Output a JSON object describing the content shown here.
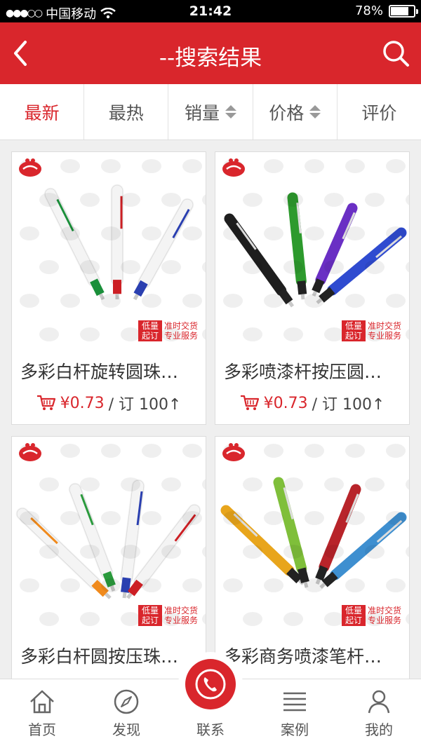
{
  "status_bar": {
    "carrier": "中国移动",
    "time": "21:42",
    "battery": "78%",
    "battery_level": 0.78
  },
  "nav": {
    "title": "--搜索结果",
    "back_icon": "chevron-left-icon",
    "search_icon": "search-icon"
  },
  "sort_tabs": [
    {
      "label": "最新",
      "active": true
    },
    {
      "label": "最热",
      "active": false
    },
    {
      "label": "销量",
      "active": false
    },
    {
      "label": "价格",
      "active": false
    },
    {
      "label": "评价",
      "active": false
    }
  ],
  "products": [
    {
      "name": "多彩白杆旋转圆珠…",
      "price": "¥0.73",
      "moq": "/ 订 100↑",
      "pen_colors": [
        "#1a8f3a",
        "#cc1f24",
        "#2a3fb0"
      ],
      "barrel": "#f4f4f4"
    },
    {
      "name": "多彩喷漆杆按压圆…",
      "price": "¥0.73",
      "moq": "/ 订 100↑",
      "pen_colors": [
        "#1e1e1e",
        "#2d9a2d",
        "#6a2fc4",
        "#2f4bd0"
      ],
      "barrel": "colored"
    },
    {
      "name": "多彩白杆圆按压珠…",
      "price": "",
      "moq": "",
      "pen_colors": [
        "#f08a1c",
        "#2a9a3c",
        "#2a3fb0",
        "#cc1f24"
      ],
      "barrel": "#f4f4f4"
    },
    {
      "name": "多彩商务喷漆笔杆…",
      "price": "",
      "moq": "",
      "pen_colors": [
        "#e8a51c",
        "#7fbf3a",
        "#b8242a",
        "#3e8fd0"
      ],
      "barrel": "colored"
    }
  ],
  "stamp": {
    "left": "低量起订",
    "right_top": "准时交货",
    "right_bottom": "专业服务"
  },
  "tab_bar": [
    {
      "label": "首页",
      "icon": "home-icon"
    },
    {
      "label": "发现",
      "icon": "compass-icon"
    },
    {
      "label": "联系",
      "icon": "phone-icon"
    },
    {
      "label": "案例",
      "icon": "list-icon"
    },
    {
      "label": "我的",
      "icon": "user-icon"
    }
  ],
  "colors": {
    "brand": "#d9262c"
  }
}
